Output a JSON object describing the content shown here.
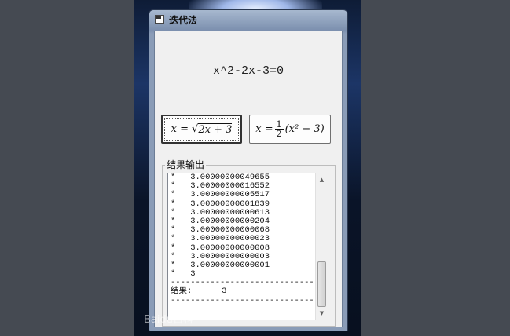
{
  "window": {
    "title": "迭代法"
  },
  "equation": "x^2-2x-3=0",
  "buttons": [
    {
      "lhs": "x =",
      "radical": "2x + 3"
    },
    {
      "lhs": "x =",
      "frac_num": "1",
      "frac_den": "2",
      "rest": "(x² − 3)"
    }
  ],
  "output_group": {
    "label": "结果输出",
    "lines": [
      "*   3.00000000049655",
      "*   3.00000000016552",
      "*   3.00000000005517",
      "*   3.00000000001839",
      "*   3.00000000000613",
      "*   3.00000000000204",
      "*   3.00000000000068",
      "*   3.00000000000023",
      "*   3.00000000000008",
      "*   3.00000000000003",
      "*   3.00000000000001",
      "*   3",
      "------------------------------",
      "结果:      3",
      "------------------------------"
    ]
  },
  "scrollbar": {
    "up_icon": "scroll-up-arrow",
    "down_icon": "scroll-down-arrow"
  },
  "watermark": "Baidu百科"
}
